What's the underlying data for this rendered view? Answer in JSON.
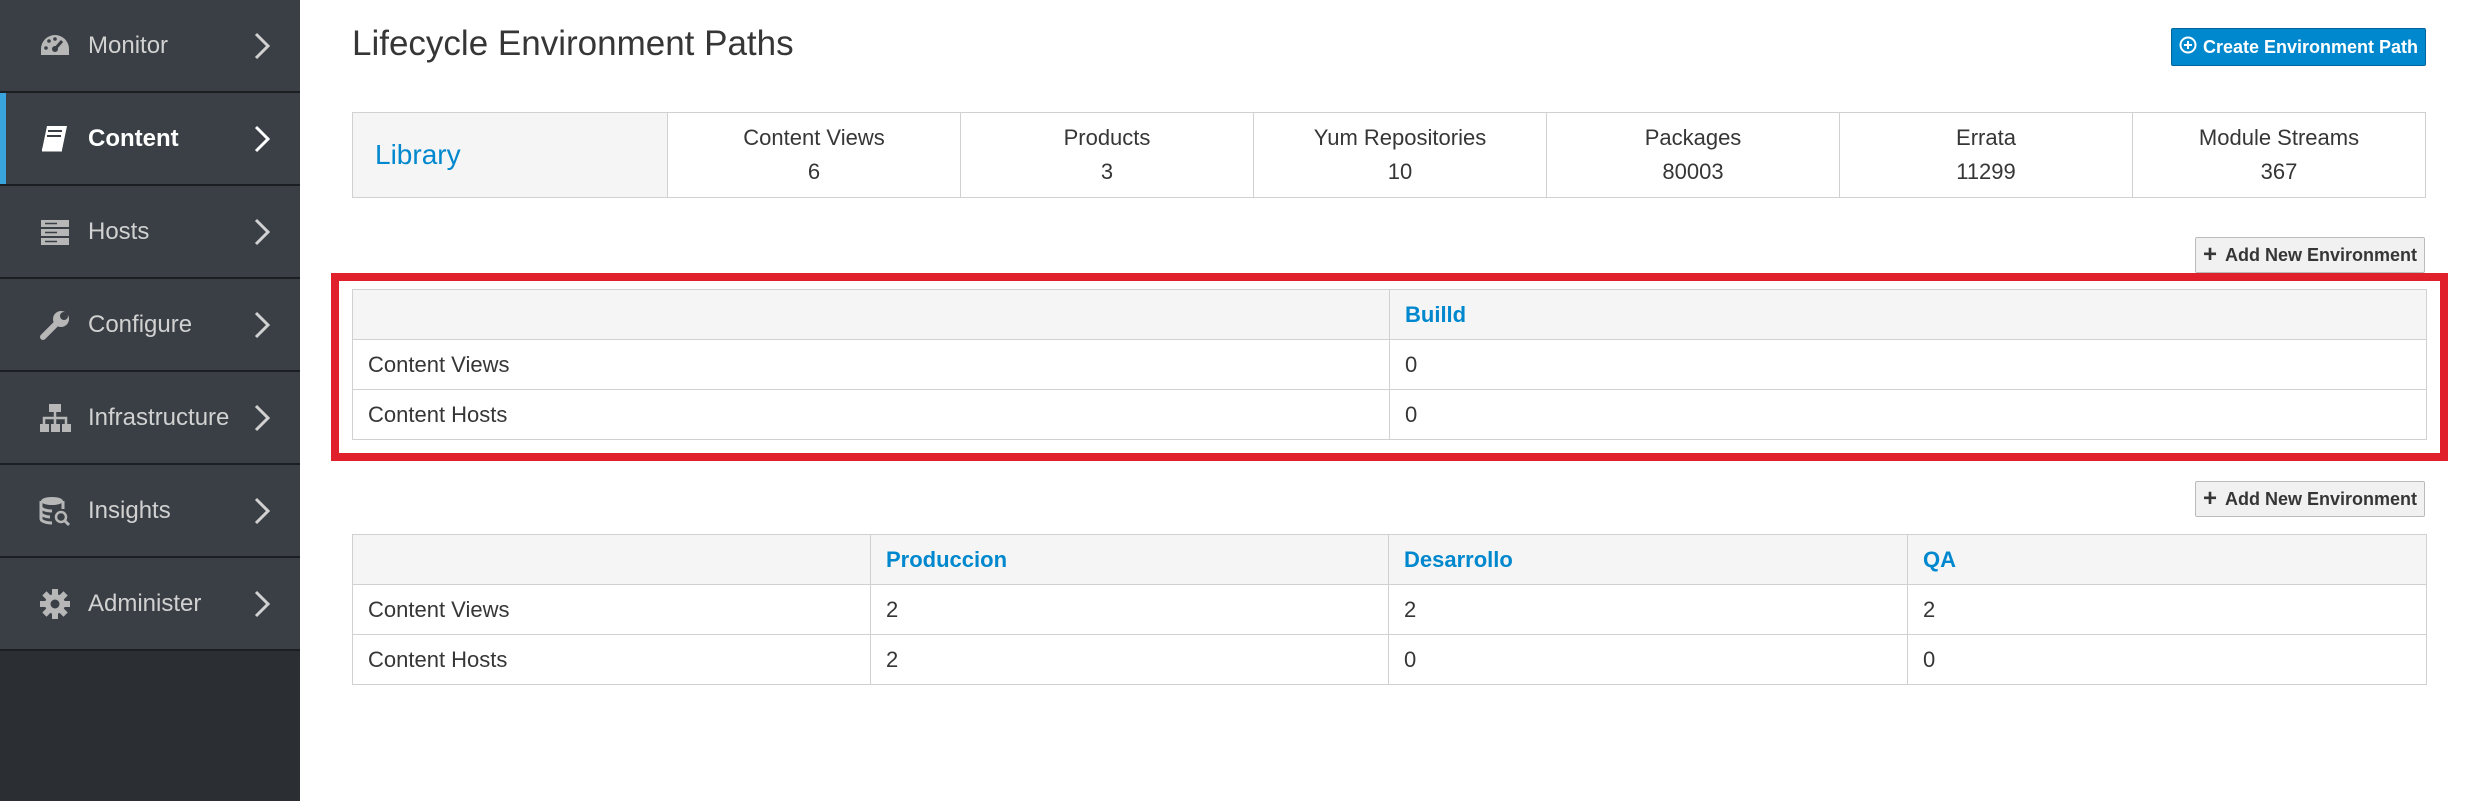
{
  "sidebar": {
    "items": [
      {
        "label": "Monitor",
        "icon": "dashboard-icon",
        "active": false
      },
      {
        "label": "Content",
        "icon": "book-icon",
        "active": true
      },
      {
        "label": "Hosts",
        "icon": "server-icon",
        "active": false
      },
      {
        "label": "Configure",
        "icon": "wrench-icon",
        "active": false
      },
      {
        "label": "Infrastructure",
        "icon": "network-icon",
        "active": false
      },
      {
        "label": "Insights",
        "icon": "database-search-icon",
        "active": false
      },
      {
        "label": "Administer",
        "icon": "gear-icon",
        "active": false
      }
    ]
  },
  "header": {
    "title": "Lifecycle Environment Paths",
    "create_button": "Create Environment Path"
  },
  "library": {
    "name": "Library",
    "stats": [
      {
        "label": "Content Views",
        "value": "6"
      },
      {
        "label": "Products",
        "value": "3"
      },
      {
        "label": "Yum Repositories",
        "value": "10"
      },
      {
        "label": "Packages",
        "value": "80003"
      },
      {
        "label": "Errata",
        "value": "11299"
      },
      {
        "label": "Module Streams",
        "value": "367"
      }
    ]
  },
  "paths": [
    {
      "add_button": "Add New Environment",
      "environments": [
        "Builld"
      ],
      "rows": [
        {
          "label": "Content Views",
          "values": [
            "0"
          ]
        },
        {
          "label": "Content Hosts",
          "values": [
            "0"
          ]
        }
      ]
    },
    {
      "add_button": "Add New Environment",
      "environments": [
        "Produccion",
        "Desarrollo",
        "QA"
      ],
      "rows": [
        {
          "label": "Content Views",
          "values": [
            "2",
            "2",
            "2"
          ]
        },
        {
          "label": "Content Hosts",
          "values": [
            "2",
            "0",
            "0"
          ]
        }
      ]
    }
  ],
  "colors": {
    "sidebar_bg": "#393f44",
    "accent": "#0088ce",
    "highlight": "#e0202a"
  }
}
